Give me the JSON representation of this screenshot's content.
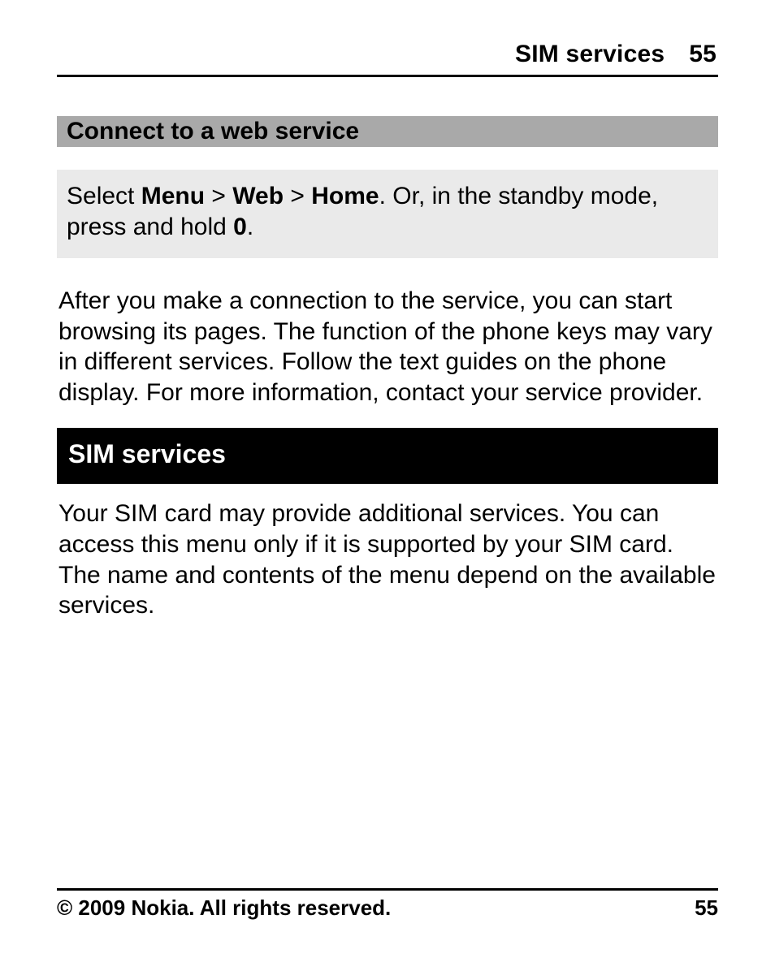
{
  "header": {
    "section": "SIM services",
    "page": "55"
  },
  "subheading": "Connect to a web service",
  "instruction": {
    "lead": "Select ",
    "menu": "Menu",
    "gt1": " > ",
    "web": "Web",
    "gt2": " > ",
    "home": "Home",
    "tail1": ". Or, in the standby mode, press and hold ",
    "zero": "0",
    "tail2": "."
  },
  "para_after": "After you make a connection to the service, you can start browsing its pages. The function of the phone keys may vary in different services. Follow the text guides on the phone display. For more information, contact your service provider.",
  "section_title": "SIM services",
  "para_sim": "Your SIM card may provide additional services. You can access this menu only if it is supported by your SIM card. The name and contents of the menu depend on the available services.",
  "footer": {
    "copyright": "© 2009 Nokia. All rights reserved.",
    "page": "55"
  }
}
